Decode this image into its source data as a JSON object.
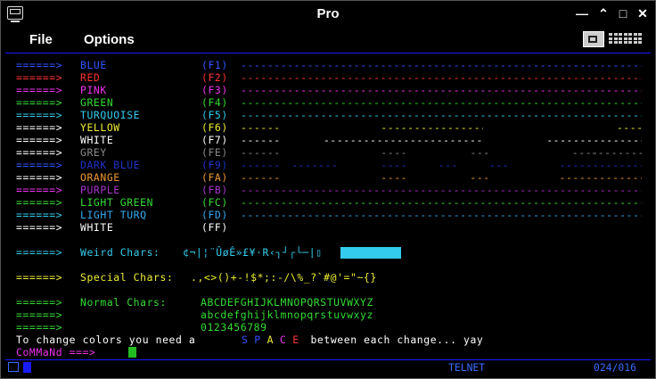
{
  "window": {
    "title": "Pro"
  },
  "menu": {
    "items": [
      {
        "label": "File"
      },
      {
        "label": "Options"
      }
    ]
  },
  "toolbar": {
    "icons": [
      "keyboard-lock-icon",
      "keyboard-icon"
    ]
  },
  "terminal": {
    "color_lines": [
      {
        "arrow": "======>",
        "name": "BLUE",
        "key": "(F1)",
        "color": "#3355ff",
        "arrow_color": "#3355ff",
        "pattern": "full"
      },
      {
        "arrow": "======>",
        "name": "RED",
        "key": "(F2)",
        "color": "#ff3333",
        "arrow_color": "#ff3333",
        "pattern": "full"
      },
      {
        "arrow": "======>",
        "name": "PINK",
        "key": "(F3)",
        "color": "#ee33ee",
        "arrow_color": "#ee33ee",
        "pattern": "full"
      },
      {
        "arrow": "======>",
        "name": "GREEN",
        "key": "(F4)",
        "color": "#33dd33",
        "arrow_color": "#33dd33",
        "pattern": "full"
      },
      {
        "arrow": "======>",
        "name": "TURQUOISE",
        "key": "(F5)",
        "color": "#33ccee",
        "arrow_color": "#33ccee",
        "pattern": "full"
      },
      {
        "arrow": "======>",
        "name": "YELLOW",
        "key": "(F6)",
        "color": "#eeee33",
        "arrow_color": "#ffffff",
        "pattern": "p1"
      },
      {
        "arrow": "======>",
        "name": "WHITE",
        "key": "(F7)",
        "color": "#ffffff",
        "arrow_color": "#ffffff",
        "pattern": "p2"
      },
      {
        "arrow": "======>",
        "name": "GREY",
        "key": "(FE)",
        "color": "#888888",
        "arrow_color": "#ffffff",
        "pattern": "p3"
      },
      {
        "arrow": "======>",
        "name": "DARK BLUE",
        "key": "(F9)",
        "color": "#2233cc",
        "arrow_color": "#3355ff",
        "pattern": "p4"
      },
      {
        "arrow": "======>",
        "name": "ORANGE",
        "key": "(FA)",
        "color": "#ee9933",
        "arrow_color": "#ffffff",
        "pattern": "p5"
      },
      {
        "arrow": "======>",
        "name": "PURPLE",
        "key": "(FB)",
        "color": "#aa33cc",
        "arrow_color": "#ee33ee",
        "pattern": "full"
      },
      {
        "arrow": "======>",
        "name": "LIGHT GREEN",
        "key": "(FC)",
        "color": "#33dd33",
        "arrow_color": "#33dd33",
        "pattern": "full"
      },
      {
        "arrow": "======>",
        "name": "LIGHT TURQ",
        "key": "(FD)",
        "color": "#33aaee",
        "arrow_color": "#33ccee",
        "pattern": "full"
      },
      {
        "arrow": "======>",
        "name": "WHITE",
        "key": "(FF)",
        "color": "#ffffff",
        "arrow_color": "#ffffff",
        "pattern": "none"
      }
    ],
    "weird": {
      "arrow": "======>",
      "label": "Weird Chars:",
      "chars": "¢¬|¦¨ÛøÊ»£¥·R‹┐┘┌└─|▯",
      "color": "#33ccee"
    },
    "special": {
      "arrow": "======>",
      "label": "Special Chars:",
      "chars": ".,<>()+-!$*;:-/\\%_?`#@'=\"~{}",
      "color": "#eeee33"
    },
    "normal": {
      "arrow": "======>",
      "label": "Normal Chars:",
      "row1": "ABCDEFGHIJKLMNOPQRSTUVWXYZ",
      "row2": "abcdefghijklmnopqrstuvwxyz",
      "row3": "0123456789",
      "color": "#33dd33"
    },
    "change_line": {
      "prefix": "To change colors you need a ",
      "letters": [
        {
          "ch": "S",
          "color": "#3355ff"
        },
        {
          "ch": "P",
          "color": "#3355ff"
        },
        {
          "ch": "A",
          "color": "#eeee33"
        },
        {
          "ch": "C",
          "color": "#ee33ee"
        },
        {
          "ch": "E",
          "color": "#ff3333"
        }
      ],
      "suffix": " between each change... yay"
    },
    "command": {
      "prompt": "CoMMaNd ===>",
      "color": "#ee33ee"
    }
  },
  "status": {
    "mode": "TELNET",
    "position": "024/016"
  }
}
